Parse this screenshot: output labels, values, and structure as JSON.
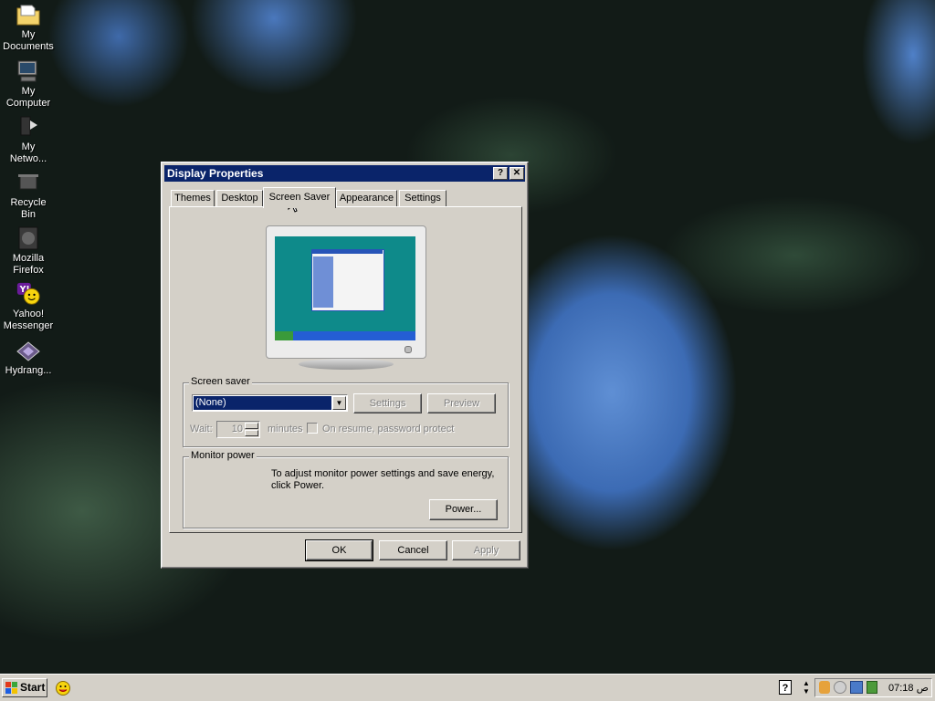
{
  "desktop_icons": [
    {
      "label_line1": "My",
      "label_line2": "Documents",
      "icon": "folder-icon"
    },
    {
      "label_line1": "My",
      "label_line2": "Computer",
      "icon": "computer-icon"
    },
    {
      "label_line1": "My",
      "label_line2": "Netwo...",
      "icon": "network-icon"
    },
    {
      "label_line1": "Recycle",
      "label_line2": "Bin",
      "icon": "recycle-bin-icon"
    },
    {
      "label_line1": "Mozilla",
      "label_line2": "Firefox",
      "icon": "firefox-icon"
    },
    {
      "label_line1": "Yahoo!",
      "label_line2": "Messenger",
      "icon": "yahoo-messenger-icon"
    },
    {
      "label_line1": "Hydrang...",
      "label_line2": "",
      "icon": "image-file-icon"
    }
  ],
  "dialog": {
    "title": "Display Properties",
    "help_button": "?",
    "close_button": "✕",
    "tabs": [
      "Themes",
      "Desktop",
      "Screen Saver",
      "Appearance",
      "Settings"
    ],
    "active_tab": "Screen Saver",
    "screen_saver": {
      "group_label": "Screen saver",
      "selected": "(None)",
      "settings_button": "Settings",
      "preview_button": "Preview",
      "wait_label": "Wait:",
      "wait_value": "10",
      "minutes_label": "minutes",
      "password_label": "On resume, password protect"
    },
    "monitor_power": {
      "group_label": "Monitor power",
      "description_line1": "To adjust monitor power settings and save energy,",
      "description_line2": "click Power.",
      "power_button": "Power..."
    },
    "buttons": {
      "ok": "OK",
      "cancel": "Cancel",
      "apply": "Apply"
    }
  },
  "taskbar": {
    "start_label": "Start",
    "clock": "07:18 ص"
  },
  "colors": {
    "title_bar": "#0a246a",
    "face": "#d4d0c8",
    "selection": "#0a246a",
    "monitor_screen": "#0e8a8a"
  }
}
